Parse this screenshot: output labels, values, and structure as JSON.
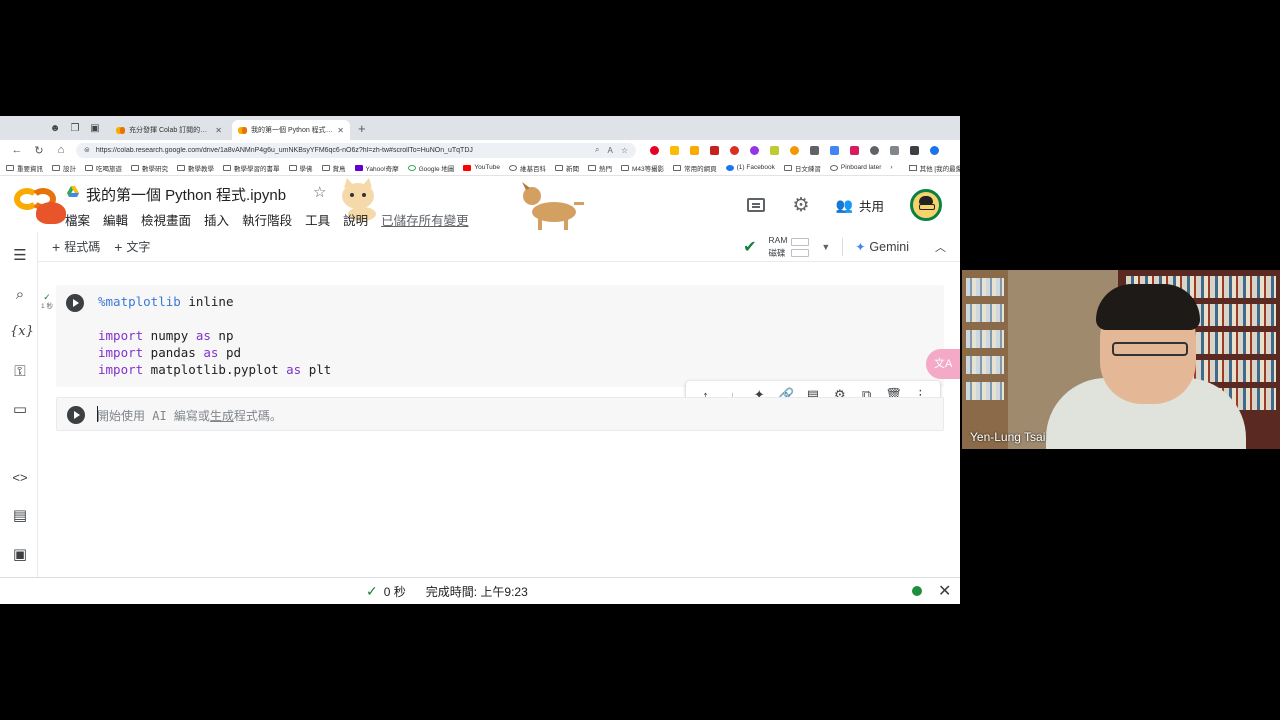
{
  "browser": {
    "tabs": [
      {
        "title": "充分發揮 Colab 訂閱的價值 - Col",
        "active": false
      },
      {
        "title": "我的第一個 Python 程式.ipynb -",
        "active": true
      }
    ],
    "new_tab": "+",
    "url": "https://colab.research.google.com/drive/1a8vANMnP4g6u_umNKBsyYFM6qc6-nO6z?hl=zh-tw#scrollTo=HuNOn_uTqTDJ",
    "bookmarks": [
      "重要資訊",
      "設計",
      "吃喝旅遊",
      "數學研究",
      "數學教學",
      "數學學習的書單",
      "學佛",
      "賞鳥",
      "Yahoo!奇摩",
      "Google 地圖",
      "YouTube",
      "維基百科",
      "新聞",
      "熱門",
      "M43等攝影",
      "常用的網頁",
      "(1) Facebook",
      "日文練習",
      "Pinboard later"
    ],
    "bookmarks_right": "其他 [我的最愛]"
  },
  "colab": {
    "title": "我的第一個 Python 程式.ipynb",
    "menu": [
      "檔案",
      "編輯",
      "檢視畫面",
      "插入",
      "執行階段",
      "工具",
      "說明"
    ],
    "saved_status": "已儲存所有變更",
    "share_label": "共用",
    "toolbar": {
      "add_code": "程式碼",
      "add_text": "文字",
      "ram_label": "RAM",
      "disk_label": "磁碟",
      "gemini_label": "Gemini"
    }
  },
  "cells": {
    "exec_time": "1 秒",
    "code_lines": {
      "l1_magic": "%matplotlib",
      "l1_rest": " inline",
      "l2_kw": "import",
      "l2_a": " numpy ",
      "l2_as": "as",
      "l2_b": " np",
      "l3_kw": "import",
      "l3_a": " pandas ",
      "l3_as": "as",
      "l3_b": " pd",
      "l4_kw": "import",
      "l4_a": " matplotlib.pyplot ",
      "l4_as": "as",
      "l4_b": " plt"
    },
    "placeholder_a": "開始使用 AI 編寫或",
    "placeholder_gen": "生成",
    "placeholder_b": "程式碼。"
  },
  "status": {
    "elapsed": "0 秒",
    "completed": "完成時間: 上午9:23"
  },
  "webcam": {
    "name": "Yen-Lung Tsai"
  },
  "icons": {
    "accent_green": "#188038",
    "colab_orange": "#f9ab00",
    "status_dot": "#1e8e3e"
  }
}
